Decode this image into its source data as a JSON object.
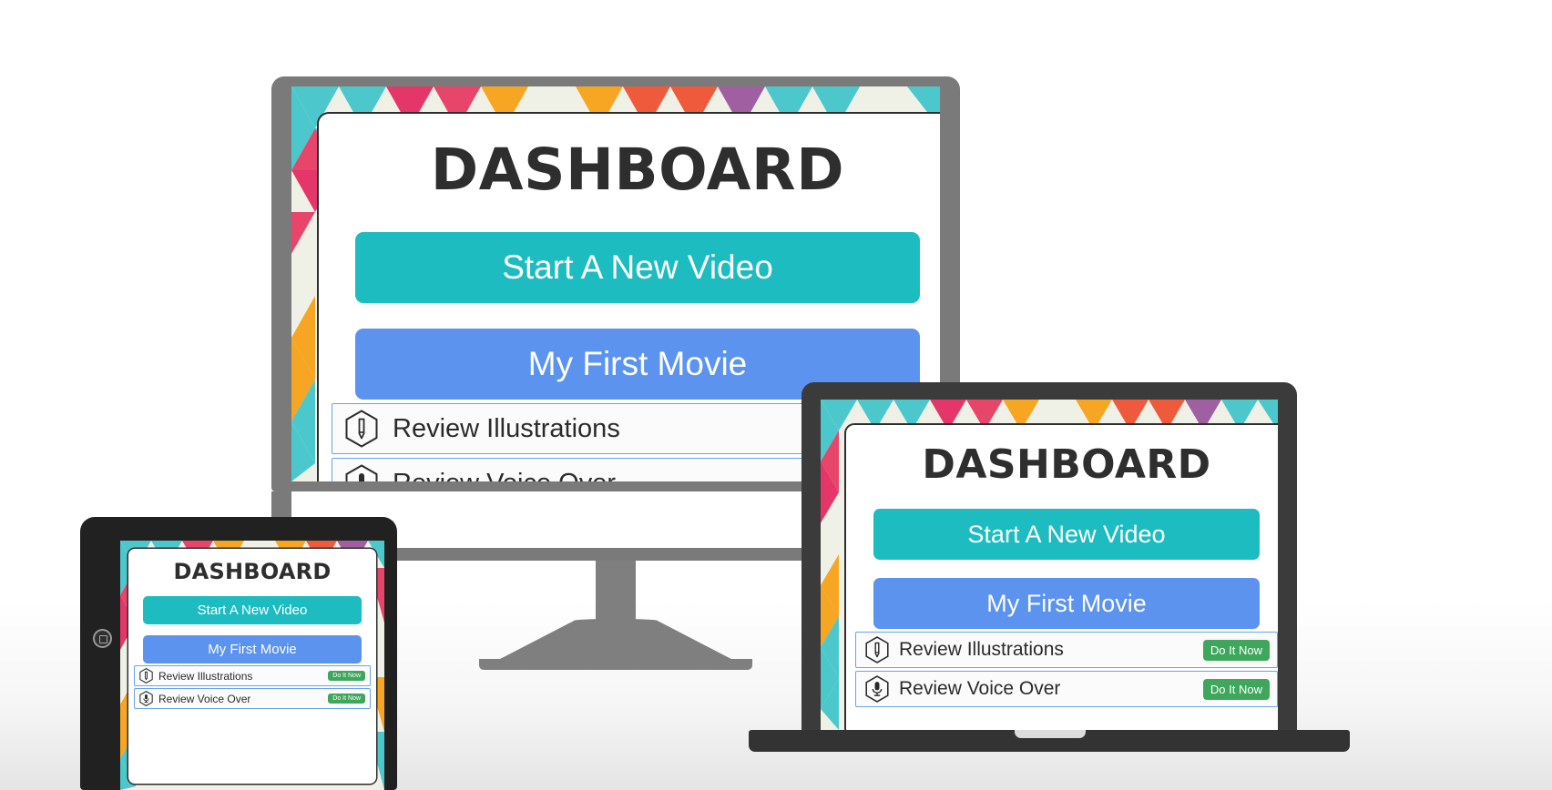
{
  "scene": {
    "background_color": "#ffffff",
    "devices": [
      "desktop-monitor",
      "laptop",
      "tablet"
    ]
  },
  "theme": {
    "accent_teal": "#1dbcc0",
    "accent_blue": "#5b93ef",
    "badge_green": "#3fa75c",
    "title_color": "#2e2e2e",
    "monitor_bezel": "#7a7a7a",
    "laptop_bezel": "#3b3b3b",
    "tablet_bezel": "#212121",
    "wallpaper_colors": [
      "#4cc8cc",
      "#e8456a",
      "#f05a3c",
      "#f6a623",
      "#f0f1e6",
      "#a05fa0",
      "#e5366a"
    ]
  },
  "app": {
    "title": "DASHBOARD",
    "primary_button": "Start A New Video",
    "project_button": "My First Movie",
    "tasks": [
      {
        "icon": "pen-hexagon-icon",
        "label": "Review Illustrations",
        "action_label": "Do It Now"
      },
      {
        "icon": "microphone-hexagon-icon",
        "label": "Review Voice Over",
        "action_label": "Do It Now"
      }
    ]
  }
}
